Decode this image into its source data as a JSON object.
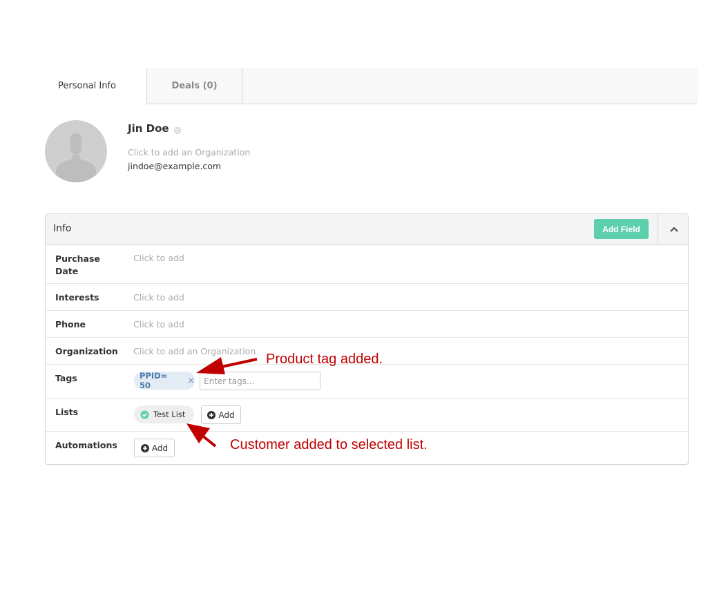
{
  "tabs": {
    "personal_info": "Personal Info",
    "deals": "Deals (0)"
  },
  "contact": {
    "name": "Jin Doe",
    "organization_placeholder": "Click to add an Organization",
    "email": "jindoe@example.com"
  },
  "panel": {
    "title": "Info",
    "add_field_label": "Add Field",
    "fields": [
      {
        "label": "Purchase Date",
        "value": "Click to add"
      },
      {
        "label": "Interests",
        "value": "Click to add"
      },
      {
        "label": "Phone",
        "value": "Click to add"
      },
      {
        "label": "Organization",
        "value": "Click to add an Organization"
      },
      {
        "label": "Tags"
      },
      {
        "label": "Lists"
      },
      {
        "label": "Automations"
      }
    ],
    "tag_chip": "PPID= 50",
    "tag_remove": "×",
    "tag_input_placeholder": "Enter tags...",
    "list_chip": "Test List",
    "lists_add_label": "Add",
    "automations_add_label": "Add"
  },
  "annotations": {
    "tag_note": "Product tag added.",
    "list_note": "Customer added to selected list."
  },
  "colors": {
    "accent_green": "#5dcfac",
    "tag_blue": "#4a78aa",
    "annotation_red": "#c00000"
  }
}
